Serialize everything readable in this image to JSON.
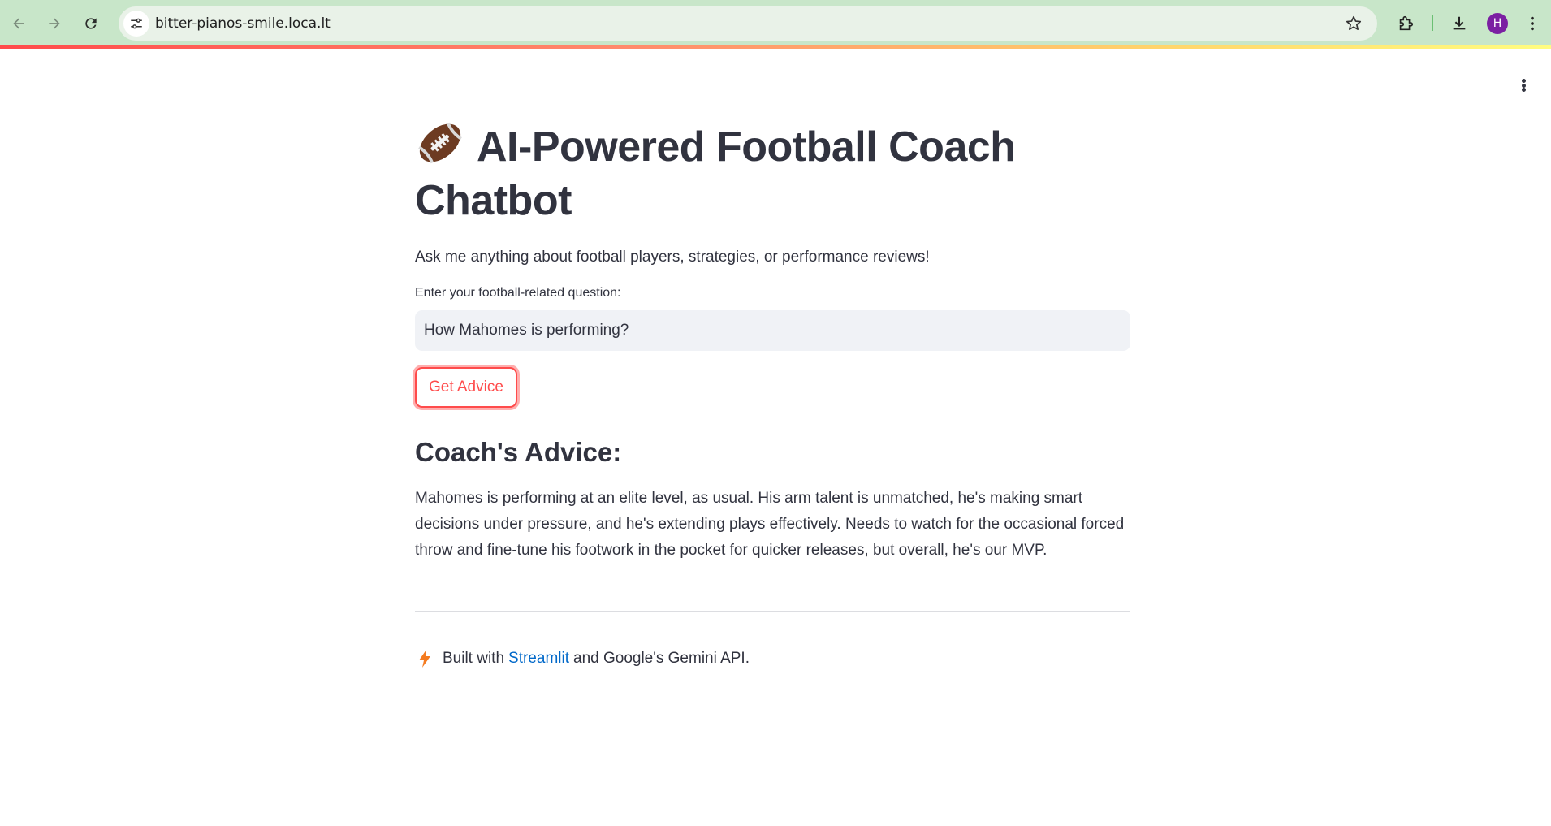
{
  "browser": {
    "url": "bitter-pianos-smile.loca.lt",
    "profile_initial": "H"
  },
  "page": {
    "title": "AI-Powered Football Coach Chatbot",
    "subtitle": "Ask me anything about football players, strategies, or performance reviews!",
    "input_label": "Enter your football-related question:",
    "input_value": "How Mahomes is performing?",
    "button_label": "Get Advice",
    "advice_heading": "Coach's Advice:",
    "advice_text": "Mahomes is performing at an elite level, as usual. His arm talent is unmatched, he's making smart decisions under pressure, and he's extending plays effectively. Needs to watch for the occasional forced throw and fine-tune his footwork in the pocket for quicker releases, but overall, he's our MVP.",
    "footer": {
      "prefix": "Built with",
      "link_text": "Streamlit",
      "suffix": "and Google's Gemini API."
    }
  },
  "colors": {
    "accent": "#ff4b4b",
    "link": "#0068c9",
    "chrome_bg": "#c8e6c9"
  }
}
